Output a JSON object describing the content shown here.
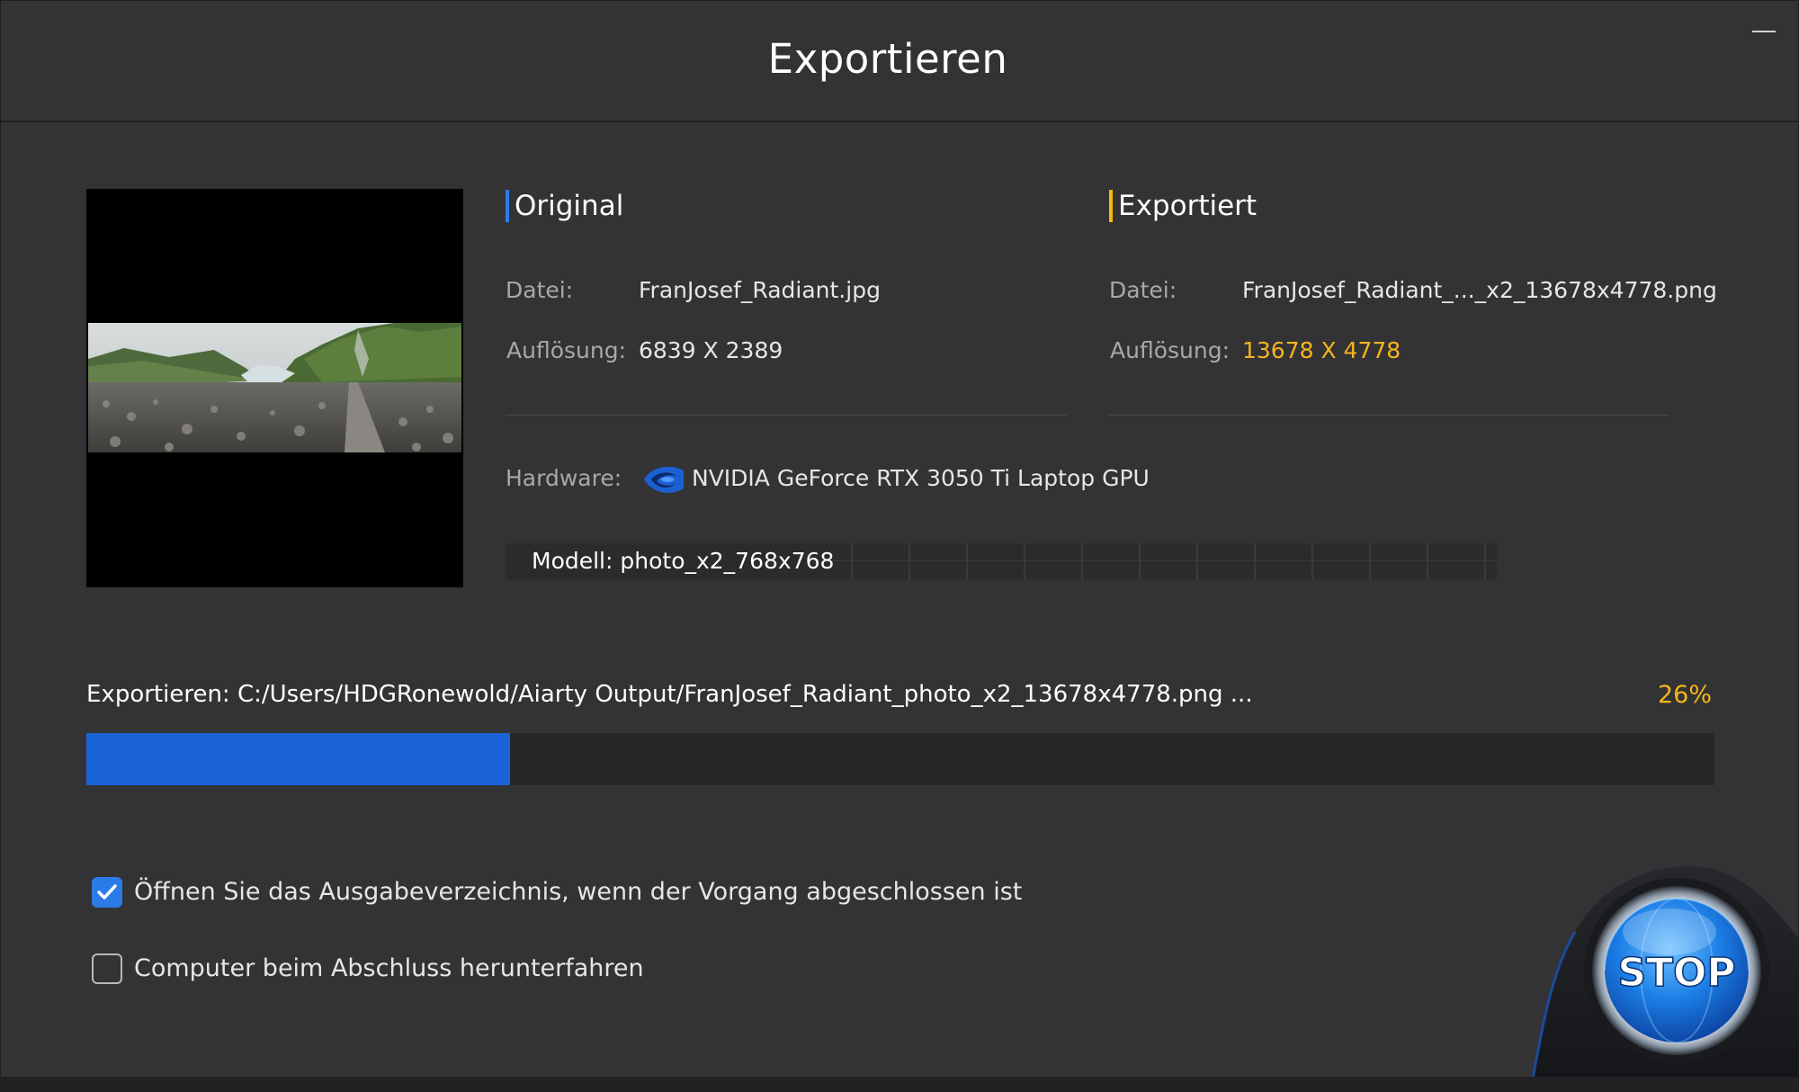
{
  "window": {
    "title": "Exportieren",
    "minimize_label": "—"
  },
  "original": {
    "heading": "Original",
    "file_label": "Datei:",
    "file_value": "FranJosef_Radiant.jpg",
    "resolution_label": "Auflösung:",
    "resolution_value": "6839 X 2389"
  },
  "exported": {
    "heading": "Exportiert",
    "file_label": "Datei:",
    "file_value": "FranJosef_Radiant_..._x2_13678x4778.png",
    "resolution_label": "Auflösung:",
    "resolution_value": "13678 X 4778"
  },
  "hardware": {
    "label": "Hardware:",
    "icon": "nvidia-icon",
    "value": "NVIDIA GeForce RTX 3050 Ti Laptop GPU"
  },
  "model": {
    "label": "Modell: photo_x2_768x768"
  },
  "progress": {
    "status_text": "Exportieren: C:/Users/HDGRonewold/Aiarty Output/FranJosef_Radiant_photo_x2_13678x4778.png ...",
    "percent_label": "26%",
    "fraction": 0.26
  },
  "options": {
    "open_folder": {
      "label": "Öffnen Sie das Ausgabeverzeichnis, wenn der Vorgang abgeschlossen ist",
      "checked": true
    },
    "shutdown": {
      "label": "Computer beim Abschluss herunterfahren",
      "checked": false
    }
  },
  "stop_button": {
    "label": "STOP"
  },
  "colors": {
    "accent_blue": "#1a63d6",
    "accent_yellow": "#f5b61b",
    "background": "#333335"
  }
}
